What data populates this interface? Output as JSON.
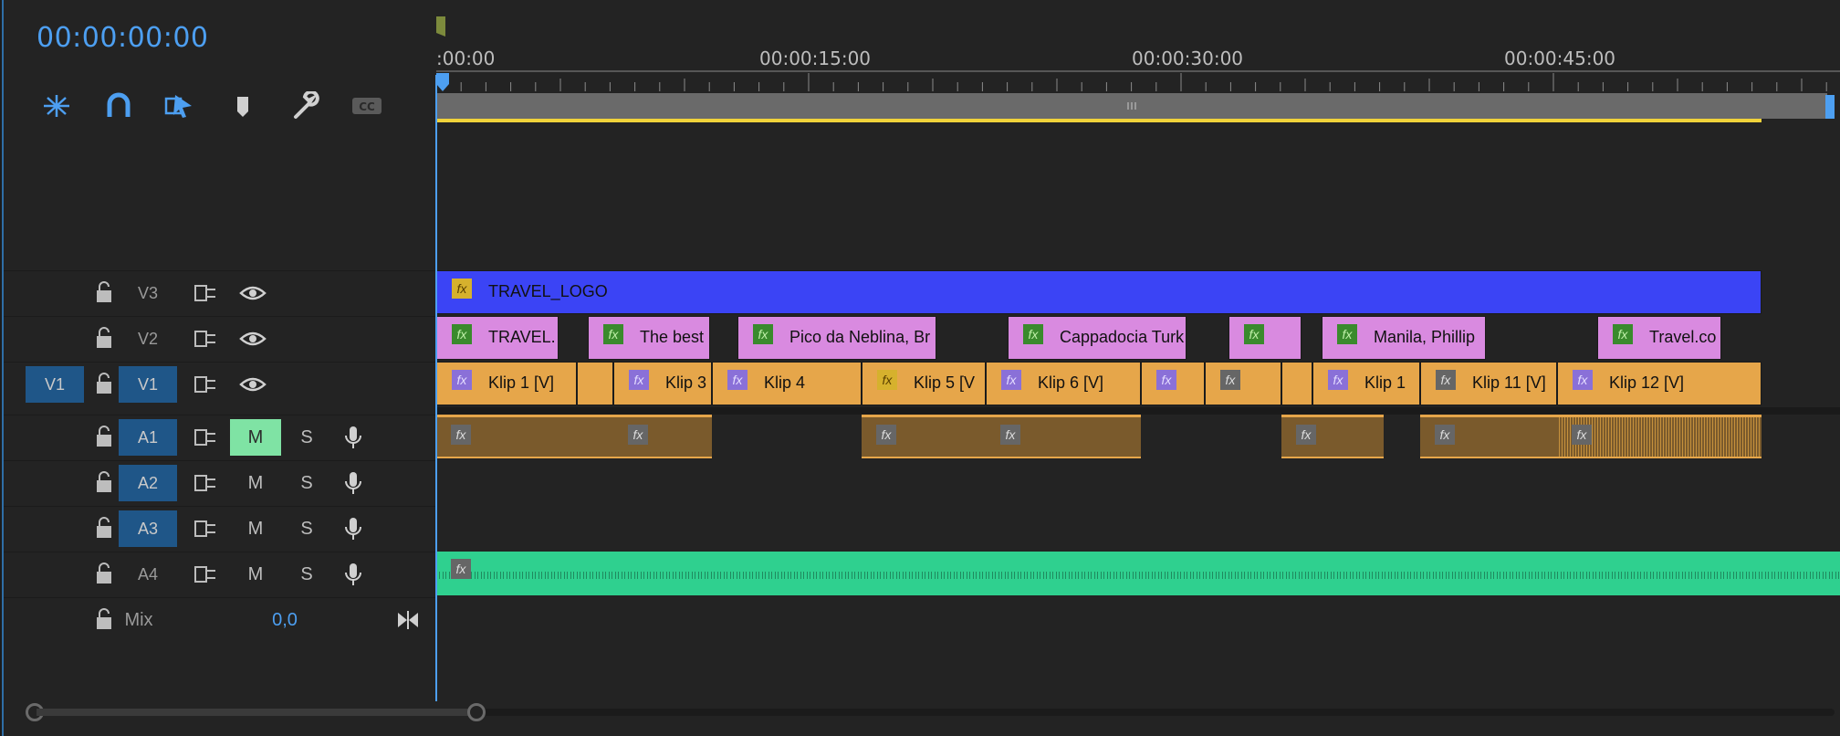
{
  "timecode": "00:00:00:00",
  "ruler": {
    "labels": [
      ":00:00",
      "00:00:15:00",
      "00:00:30:00",
      "00:00:45:00"
    ]
  },
  "tools": [
    {
      "name": "ripple-icon"
    },
    {
      "name": "snap-icon"
    },
    {
      "name": "linked-selection-icon"
    },
    {
      "name": "add-marker-icon"
    },
    {
      "name": "settings-wrench-icon"
    },
    {
      "name": "captions-icon",
      "label": "CC"
    }
  ],
  "tracks": {
    "video": [
      {
        "label": "V3",
        "source": ""
      },
      {
        "label": "V2",
        "source": ""
      },
      {
        "label": "V1",
        "source": "V1"
      }
    ],
    "audio": [
      {
        "label": "A1",
        "m": "M",
        "s": "S",
        "muted": true
      },
      {
        "label": "A2",
        "m": "M",
        "s": "S",
        "muted": false
      },
      {
        "label": "A3",
        "m": "M",
        "s": "S",
        "muted": false
      },
      {
        "label": "A4",
        "m": "M",
        "s": "S",
        "muted": false
      }
    ],
    "mix": {
      "label": "Mix",
      "value": "0,0"
    }
  },
  "clips": {
    "v3": [
      {
        "name": "TRAVEL_LOGO",
        "fx": "fx"
      }
    ],
    "v2": [
      {
        "name": "TRAVEL.",
        "fx": "fx"
      },
      {
        "name": "The best",
        "fx": "fx"
      },
      {
        "name": "Pico da Neblina, Br",
        "fx": "fx"
      },
      {
        "name": "Cappadocia Turk",
        "fx": "fx"
      },
      {
        "name": "",
        "fx": "fx"
      },
      {
        "name": "Manila, Phillip",
        "fx": "fx"
      },
      {
        "name": "Travel.co",
        "fx": "fx"
      }
    ],
    "v1": [
      {
        "name": "Klip 1  [V]",
        "fx": "fx"
      },
      {
        "name": "Klip 3",
        "fx": "fx"
      },
      {
        "name": "Klip 4",
        "fx": "fx"
      },
      {
        "name": "Klip 5 [V",
        "fx": "fx"
      },
      {
        "name": "Klip 6 [V]",
        "fx": "fx"
      },
      {
        "name": "",
        "fx": "fx"
      },
      {
        "name": "",
        "fx": "fx"
      },
      {
        "name": "Klip 1",
        "fx": "fx"
      },
      {
        "name": "Klip 11 [V]",
        "fx": "fx"
      },
      {
        "name": "Klip 12 [V]",
        "fx": "fx"
      }
    ]
  },
  "colors": {
    "accent": "#4d9ff1",
    "v3_clip": "#3b44f5",
    "v2_clip": "#d98ae0",
    "v1_clip": "#e6a64a",
    "a4_wave": "#2fd08f",
    "mute_on": "#7fe3a4",
    "work_area": "#f0d23a"
  }
}
